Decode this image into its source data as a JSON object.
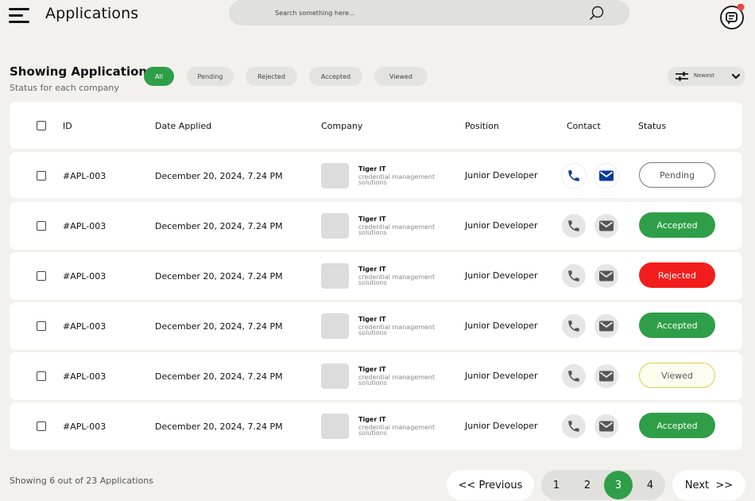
{
  "header": {
    "title": "Applications",
    "search_placeholder": "Search something here..."
  },
  "filters": {
    "heading": "Showing Application",
    "subheading": "Status for each company",
    "chips": [
      "All",
      "Pending",
      "Rejected",
      "Accepted",
      "Viewed"
    ],
    "active_chip": "All",
    "sort_label": "Newest"
  },
  "table": {
    "columns": [
      "ID",
      "Date Applied",
      "Company",
      "Position",
      "Contact",
      "Status"
    ],
    "rows": [
      {
        "id": "#APL-003",
        "date": "December 20, 2024, 7.24 PM",
        "company": "Tiger IT",
        "company_desc": "credential management solutions",
        "position": "Junior Developer",
        "status": "Pending"
      },
      {
        "id": "#APL-003",
        "date": "December 20, 2024, 7.24 PM",
        "company": "Tiger IT",
        "company_desc": "credential management solutions",
        "position": "Junior Developer",
        "status": "Accepted"
      },
      {
        "id": "#APL-003",
        "date": "December 20, 2024, 7.24 PM",
        "company": "Tiger IT",
        "company_desc": "credential management solutions",
        "position": "Junior Developer",
        "status": "Rejected"
      },
      {
        "id": "#APL-003",
        "date": "December 20, 2024, 7.24 PM",
        "company": "Tiger IT",
        "company_desc": "credential management solutions",
        "position": "Junior Developer",
        "status": "Accepted"
      },
      {
        "id": "#APL-003",
        "date": "December 20, 2024, 7.24 PM",
        "company": "Tiger IT",
        "company_desc": "credential management solutions",
        "position": "Junior Developer",
        "status": "Viewed"
      },
      {
        "id": "#APL-003",
        "date": "December 20, 2024, 7.24 PM",
        "company": "Tiger IT",
        "company_desc": "credential management solutions",
        "position": "Junior Developer",
        "status": "Accepted"
      }
    ]
  },
  "footer": {
    "summary": "Showing 6 out of 23 Applications",
    "previous_label": "<< Previous",
    "next_label": "Next  >>",
    "pages": [
      "1",
      "2",
      "3",
      "4"
    ],
    "current_page": "3"
  },
  "colors": {
    "accent_green": "#2f9e48",
    "rejected_red": "#f31d1d",
    "viewed_border": "#e8c84a",
    "contact_blue": "#0b3b9e",
    "notification_red": "#ef4444"
  }
}
